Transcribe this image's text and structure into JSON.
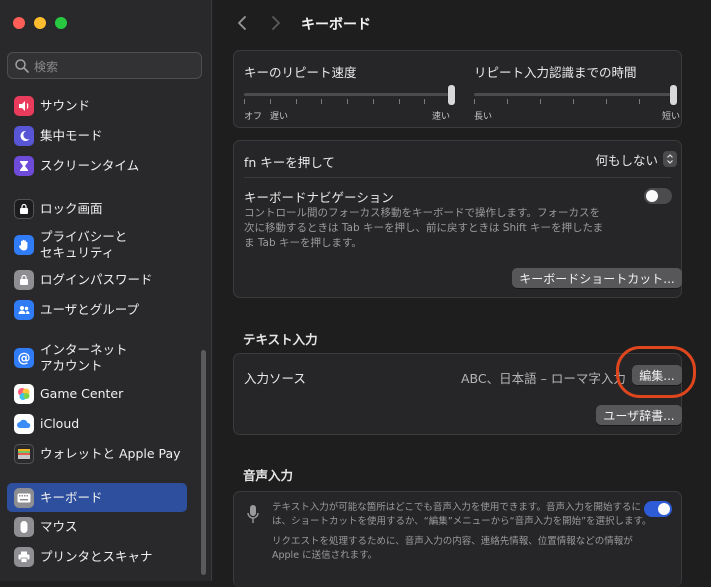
{
  "window": {
    "title": "キーボード"
  },
  "search": {
    "placeholder": "検索"
  },
  "sidebar": {
    "items": [
      {
        "label": "サウンド",
        "icon": "speaker-icon",
        "color": "#e93b5c",
        "selected": false
      },
      {
        "label": "集中モード",
        "icon": "moon-icon",
        "color": "#5856d6",
        "selected": false
      },
      {
        "label": "スクリーンタイム",
        "icon": "hourglass-icon",
        "color": "#6e4bd8",
        "selected": false
      },
      {
        "label": "ロック画面",
        "icon": "lock-screen-icon",
        "color": "#1c1c1e",
        "selected": false
      },
      {
        "label": "プライバシーと\nセキュリティ",
        "icon": "hand-icon",
        "color": "#2f7cf6",
        "selected": false
      },
      {
        "label": "ログインパスワード",
        "icon": "lock-icon",
        "color": "#8e8e93",
        "selected": false
      },
      {
        "label": "ユーザとグループ",
        "icon": "users-icon",
        "color": "#2f7cf6",
        "selected": false
      },
      {
        "label": "インターネット\nアカウント",
        "icon": "at-icon",
        "color": "#2f7cf6",
        "selected": false
      },
      {
        "label": "Game Center",
        "icon": "game-center-icon",
        "color": "#ffffff",
        "selected": false
      },
      {
        "label": "iCloud",
        "icon": "cloud-icon",
        "color": "#ffffff",
        "selected": false
      },
      {
        "label": "ウォレットと Apple Pay",
        "icon": "wallet-icon",
        "color": "#1c1c1e",
        "selected": false
      },
      {
        "label": "キーボード",
        "icon": "keyboard-icon",
        "color": "#8e8e93",
        "selected": true
      },
      {
        "label": "マウス",
        "icon": "mouse-icon",
        "color": "#8e8e93",
        "selected": false
      },
      {
        "label": "プリンタとスキャナ",
        "icon": "printer-icon",
        "color": "#8e8e93",
        "selected": false
      }
    ]
  },
  "repeat": {
    "rate_label": "キーのリピート速度",
    "rate_min": "オフ",
    "rate_slow": "遅い",
    "rate_fast": "速い",
    "rate_value": 1.0,
    "delay_label": "リピート入力認識までの時間",
    "delay_long": "長い",
    "delay_short": "短い",
    "delay_value": 1.0
  },
  "fn": {
    "label": "fn キーを押して",
    "value": "何もしない"
  },
  "nav": {
    "label": "キーボードナビゲーション",
    "desc": "コントロール間のフォーカス移動をキーボードで操作します。フォーカスを次に移動するときは Tab キーを押し、前に戻すときは Shift キーを押したまま Tab キーを押します。",
    "toggle_on": false
  },
  "shortcuts_button": "キーボードショートカット...",
  "text_input": {
    "title": "テキスト入力",
    "source_label": "入力ソース",
    "source_value": "ABC、日本語 – ローマ字入力",
    "edit_button": "編集...",
    "dict_button": "ユーザ辞書..."
  },
  "dictation": {
    "title": "音声入力",
    "desc1": "テキスト入力が可能な箇所はどこでも音声入力を使用できます。音声入力を開始するには、ショートカットを使用するか、“編集”メニューから“音声入力を開始”を選択します。",
    "desc2": "リクエストを処理するために、音声入力の内容、連絡先情報、位置情報などの情報が Apple に送信されます。",
    "toggle_on": true
  },
  "colors": {
    "accent": "#2e5bd6",
    "selected": "#2e4f9e",
    "highlight": "#e0461e"
  }
}
